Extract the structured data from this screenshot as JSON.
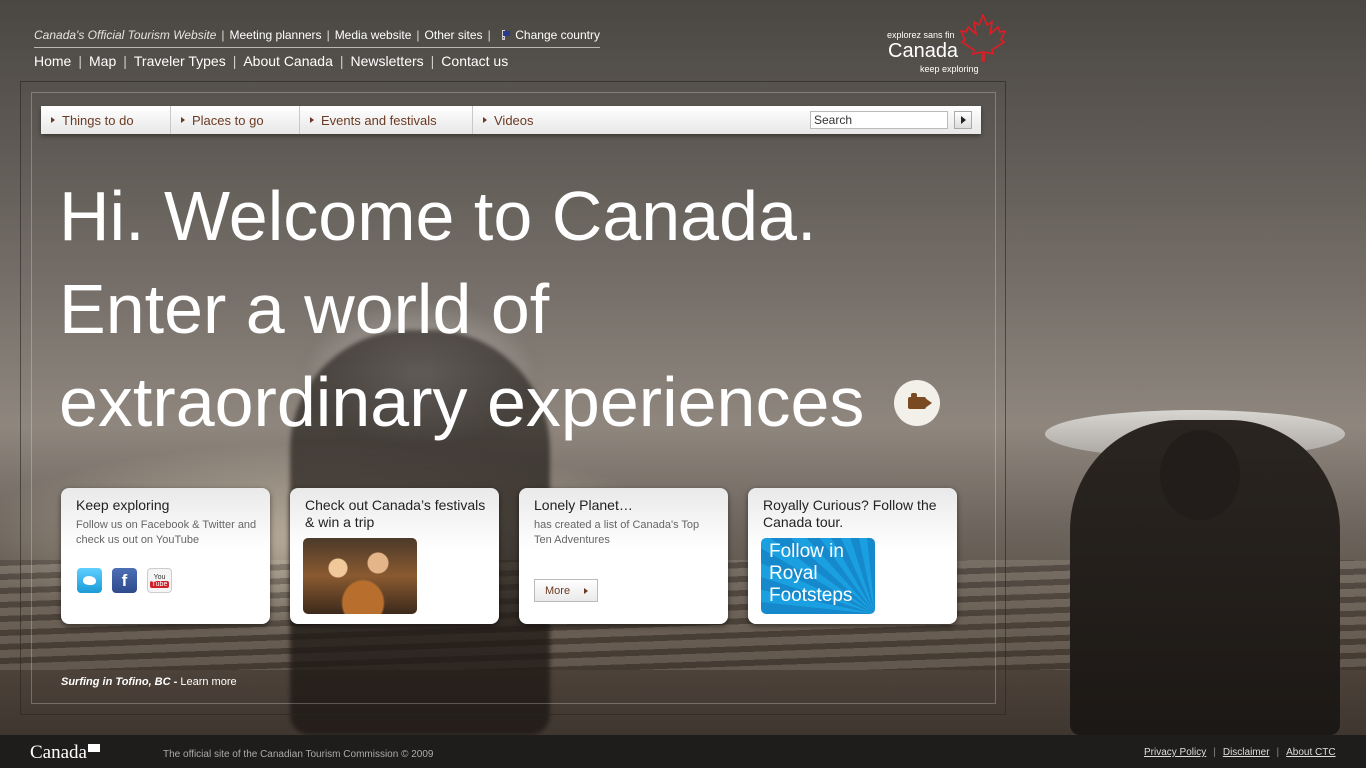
{
  "top_links": {
    "official": "Canada's Official Tourism Website",
    "meeting": "Meeting planners",
    "media": "Media website",
    "other": "Other sites",
    "country": "Change country",
    "separator": "|"
  },
  "main_nav": [
    "Home",
    "Map",
    "Traveler Types",
    "About Canada",
    "Newsletters",
    "Contact us"
  ],
  "logo": {
    "tagline": "explorez sans fin",
    "wordmark": "Canada",
    "sub": "keep exploring",
    "color": "#e31b23"
  },
  "nav_bar": {
    "tabs": [
      "Things to do",
      "Places to go",
      "Events and festivals",
      "Videos"
    ],
    "search_value": "Search"
  },
  "headline": {
    "line1": "Hi. Welcome to Canada.",
    "line2": "Enter a world of",
    "line3": "extraordinary experiences"
  },
  "cards": {
    "keep": {
      "title": "Keep exploring",
      "body": "Follow us on Facebook & Twitter and check us out on YouTube",
      "fb_letter": "f",
      "yt_top": "You",
      "yt_bottom": "Tube"
    },
    "festivals": {
      "title": "Check out Canada’s festivals & win a trip"
    },
    "lonely": {
      "title": "Lonely Planet…",
      "body": "has created a list of Canada's Top Ten Adventures",
      "more": "More"
    },
    "royal": {
      "title": "Royally Curious? Follow the Canada tour.",
      "banner": "Follow in Royal Footsteps"
    }
  },
  "caption": {
    "place": "Surfing in Tofino, BC -",
    "link": "Learn more"
  },
  "footer": {
    "wordmark": "Canada",
    "copyright": "The official site of the Canadian Tourism Commission © 2009",
    "links": [
      "Privacy Policy",
      "Disclaimer",
      "About CTC"
    ],
    "separator": "|"
  }
}
